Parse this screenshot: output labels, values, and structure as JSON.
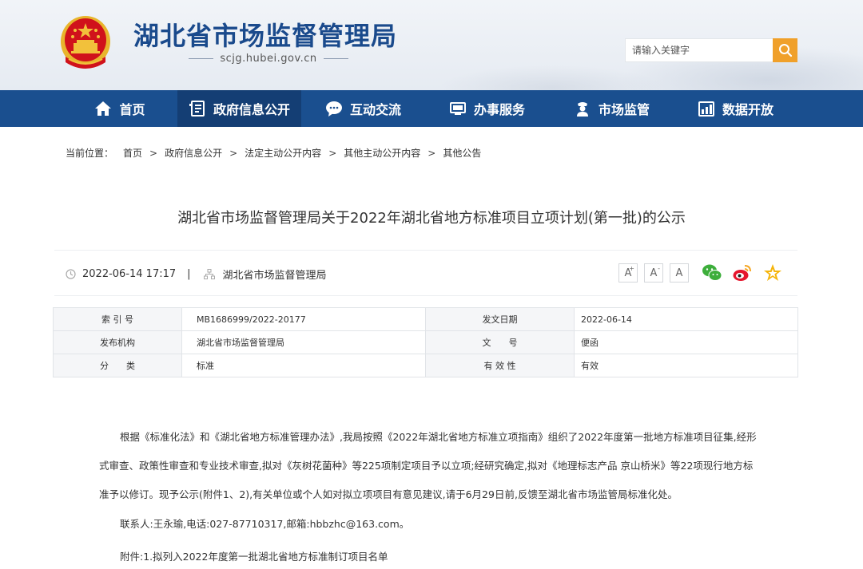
{
  "header": {
    "site_title": "湖北省市场监督管理局",
    "site_domain": "scjg.hubei.gov.cn",
    "search_placeholder": "请输入关键字"
  },
  "nav": {
    "items": [
      {
        "label": "首页",
        "icon": "home-icon"
      },
      {
        "label": "政府信息公开",
        "icon": "document-list-icon",
        "active": true
      },
      {
        "label": "互动交流",
        "icon": "chat-bubble-icon"
      },
      {
        "label": "办事服务",
        "icon": "monitor-icon"
      },
      {
        "label": "市场监管",
        "icon": "officer-icon"
      },
      {
        "label": "数据开放",
        "icon": "bar-chart-icon"
      }
    ]
  },
  "breadcrumb": {
    "label": "当前位置：",
    "items": [
      "首页",
      "政府信息公开",
      "法定主动公开内容",
      "其他主动公开内容",
      "其他公告"
    ],
    "separator": ">"
  },
  "article": {
    "title": "湖北省市场监督管理局关于2022年湖北省地方标准项目立项计划(第一批)的公示",
    "datetime": "2022-06-14 17:17",
    "meta_separator": "|",
    "publisher": "湖北省市场监督管理局"
  },
  "font_controls": [
    {
      "label": "A",
      "sup": "+"
    },
    {
      "label": "A",
      "sup": "-"
    },
    {
      "label": "A",
      "sup": ""
    }
  ],
  "share": [
    "wechat-icon",
    "weibo-icon",
    "favorite-star-icon"
  ],
  "info_table": {
    "rows": [
      {
        "k1": "索 引 号",
        "v1": "MB1686999/2022-20177",
        "k2": "发文日期",
        "v2": "2022-06-14"
      },
      {
        "k1": "发布机构",
        "v1": "湖北省市场监督管理局",
        "k2": "文　　号",
        "v2": "便函"
      },
      {
        "k1": "分　　类",
        "v1": "标准",
        "k2": "有 效 性",
        "v2": "有效"
      }
    ]
  },
  "body": {
    "paragraph": "根据《标准化法》和《湖北省地方标准管理办法》,我局按照《2022年湖北省地方标准立项指南》组织了2022年度第一批地方标准项目征集,经形式审查、政策性审查和专业技术审查,拟对《灰树花菌种》等225项制定项目予以立项;经研究确定,拟对《地理标志产品 京山桥米》等22项现行地方标准予以修订。现予公示(附件1、2),有关单位或个人如对拟立项项目有意见建议,请于6月29日前,反馈至湖北省市场监管局标准化处。",
    "contact": "联系人:王永瑜,电话:027-87710317,邮箱:hbbzhc@163.com。",
    "attachment": "附件:1.拟列入2022年度第一批湖北省地方标准制订项目名单"
  },
  "colors": {
    "nav_bg": "#1a4f8f",
    "nav_active": "#143e74",
    "title_blue": "#1a4a8c",
    "search_btn": "#f0a02a",
    "emblem_red": "#d0121b",
    "emblem_gold": "#f2c13b"
  }
}
